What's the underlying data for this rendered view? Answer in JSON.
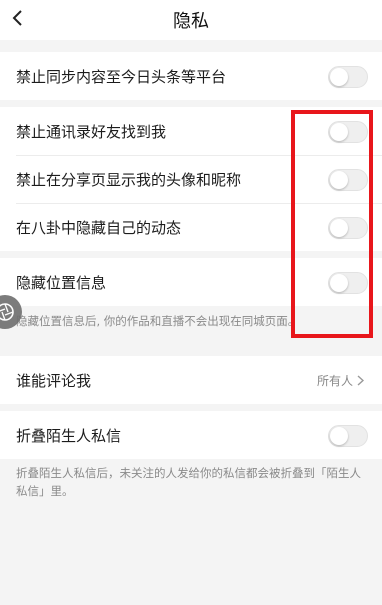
{
  "header": {
    "title": "隐私",
    "back_icon": "chevron-left-icon"
  },
  "settings": {
    "sync_block": "禁止同步内容至今日头条等平台",
    "contacts_block": "禁止通讯录好友找到我",
    "share_page_block": "禁止在分享页显示我的头像和昵称",
    "bagua_hide": "在八卦中隐藏自己的动态",
    "location_hide": "隐藏位置信息",
    "location_hint": "隐藏位置信息后, 你的作品和直播不会出现在同城页面。",
    "comment_who": "谁能评论我",
    "comment_value": "所有人",
    "fold_dm": "折叠陌生人私信",
    "fold_dm_hint": "折叠陌生人私信后，未关注的人发给你的私信都会被折叠到「陌生人私信」里。"
  },
  "toggles": {
    "sync_block": false,
    "contacts_block": false,
    "share_page_block": false,
    "bagua_hide": false,
    "location_hide": false,
    "fold_dm": false
  },
  "colors": {
    "highlight": "#e8161b",
    "background": "#f4f4f4",
    "toggle_off": "#efefef"
  }
}
